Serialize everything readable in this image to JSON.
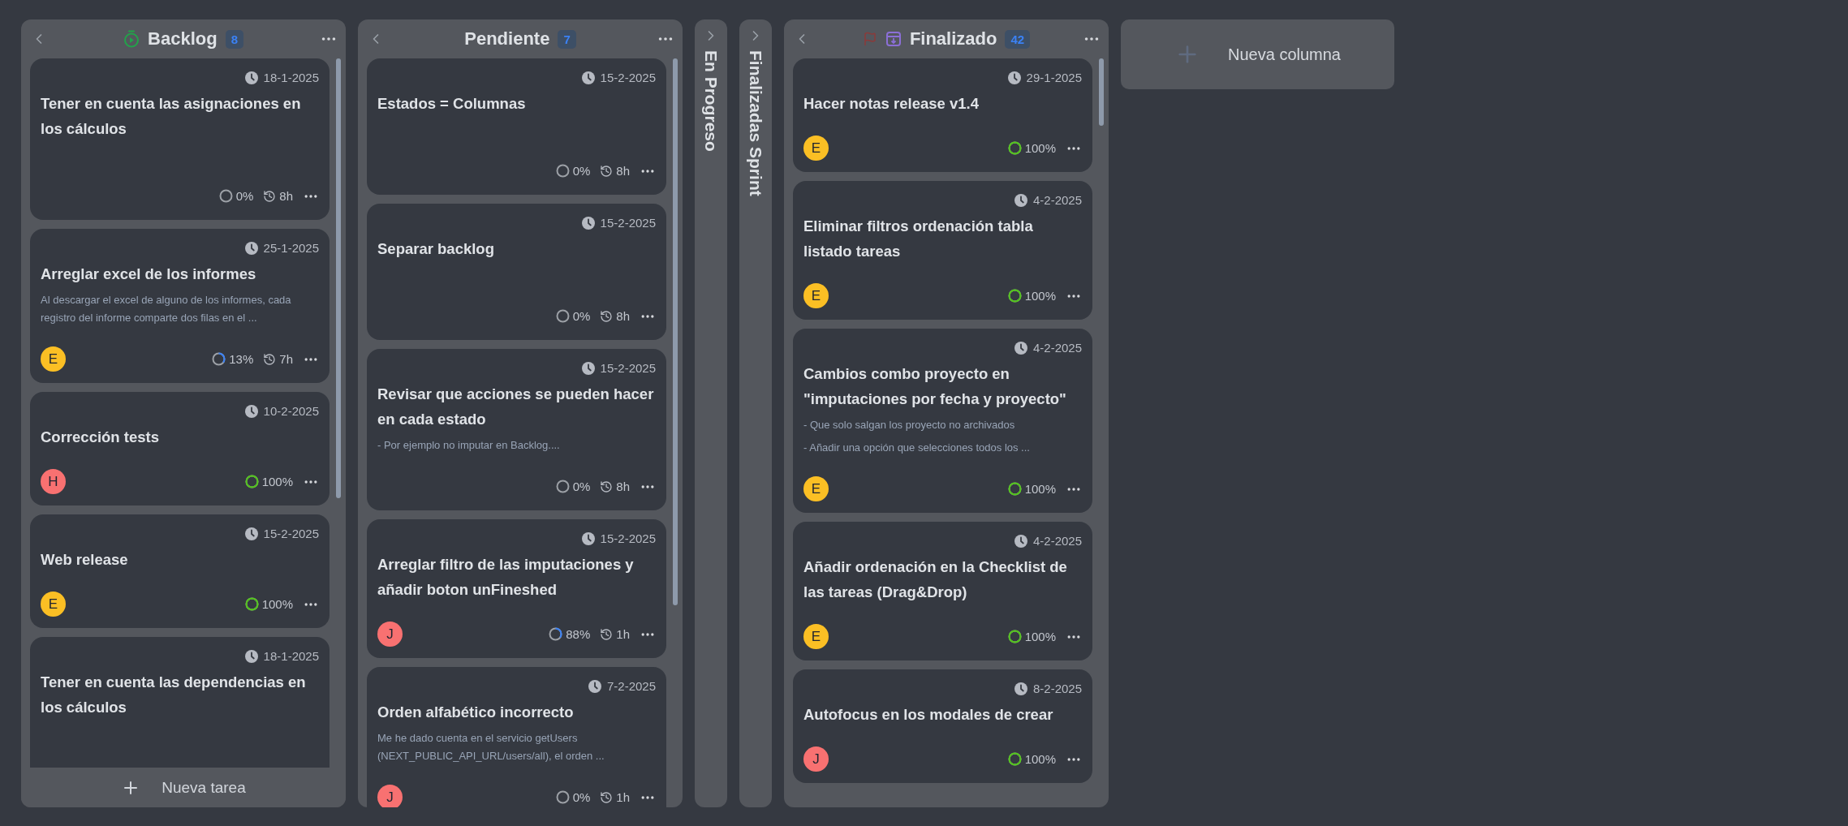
{
  "columns": [
    {
      "kind": "backlog",
      "title": "Backlog",
      "count": "8",
      "add_label": "Nueva tarea",
      "cards": [
        {
          "date": "18-1-2025",
          "title": "Tener en cuenta las asignaciones en los cálculos",
          "progress": {
            "text": "0%",
            "kind": "empty"
          },
          "hours": "8h"
        },
        {
          "date": "25-1-2025",
          "title": "Arreglar excel de los informes",
          "description": [
            "Al descargar el excel de alguno de los informes, cada registro del informe comparte dos filas en el ..."
          ],
          "assignee": {
            "initial": "E",
            "color": "#fbbf24"
          },
          "progress": {
            "text": "13%",
            "kind": "partial"
          },
          "hours": "7h"
        },
        {
          "date": "10-2-2025",
          "title": "Corrección tests",
          "assignee": {
            "initial": "H",
            "color": "#f87171"
          },
          "progress": {
            "text": "100%",
            "kind": "full"
          }
        },
        {
          "date": "15-2-2025",
          "title": "Web release",
          "assignee": {
            "initial": "E",
            "color": "#fbbf24"
          },
          "progress": {
            "text": "100%",
            "kind": "full"
          }
        },
        {
          "date": "18-1-2025",
          "title": "Tener en cuenta las dependencias en los cálculos"
        }
      ]
    },
    {
      "kind": "pending",
      "title": "Pendiente",
      "count": "7",
      "cards": [
        {
          "date": "15-2-2025",
          "title": "Estados = Columnas",
          "progress": {
            "text": "0%",
            "kind": "empty"
          },
          "hours": "8h"
        },
        {
          "date": "15-2-2025",
          "title": "Separar backlog",
          "progress": {
            "text": "0%",
            "kind": "empty"
          },
          "hours": "8h"
        },
        {
          "date": "15-2-2025",
          "title": "Revisar que acciones se pueden hacer en cada estado",
          "description": [
            "- Por ejemplo no imputar en Backlog...."
          ],
          "progress": {
            "text": "0%",
            "kind": "empty"
          },
          "hours": "8h"
        },
        {
          "date": "15-2-2025",
          "title": "Arreglar filtro de las imputaciones y añadir boton unFineshed",
          "assignee": {
            "initial": "J",
            "color": "#f87171"
          },
          "progress": {
            "text": "88%",
            "kind": "partial"
          },
          "hours": "1h"
        },
        {
          "date": "7-2-2025",
          "title": "Orden alfabético incorrecto",
          "description": [
            "Me he dado cuenta en el servicio getUsers (NEXT_PUBLIC_API_URL/users/all), el orden ..."
          ],
          "assignee": {
            "initial": "J",
            "color": "#f87171"
          },
          "progress": {
            "text": "0%",
            "kind": "empty"
          },
          "hours": "1h"
        }
      ]
    },
    {
      "kind": "collapsed",
      "title": "En Progreso"
    },
    {
      "kind": "collapsed",
      "title": "Finalizadas Sprint"
    },
    {
      "kind": "done",
      "title": "Finalizado",
      "count": "42",
      "cards": [
        {
          "date": "29-1-2025",
          "title": "Hacer notas release v1.4",
          "assignee": {
            "initial": "E",
            "color": "#fbbf24"
          },
          "progress": {
            "text": "100%",
            "kind": "full"
          }
        },
        {
          "date": "4-2-2025",
          "title": "Eliminar filtros ordenación tabla listado tareas",
          "assignee": {
            "initial": "E",
            "color": "#fbbf24"
          },
          "progress": {
            "text": "100%",
            "kind": "full"
          }
        },
        {
          "date": "4-2-2025",
          "title": "Cambios combo proyecto en \"imputaciones por fecha y proyecto\"",
          "description": [
            "- Que solo salgan los proyecto no archivados",
            "- Añadir una opción que selecciones todos los ..."
          ],
          "assignee": {
            "initial": "E",
            "color": "#fbbf24"
          },
          "progress": {
            "text": "100%",
            "kind": "full"
          }
        },
        {
          "date": "4-2-2025",
          "title": "Añadir ordenación en la Checklist de las tareas (Drag&Drop)",
          "assignee": {
            "initial": "E",
            "color": "#fbbf24"
          },
          "progress": {
            "text": "100%",
            "kind": "full"
          }
        },
        {
          "date": "8-2-2025",
          "title": "Autofocus en los modales de crear",
          "assignee": {
            "initial": "J",
            "color": "#f87171"
          },
          "progress": {
            "text": "100%",
            "kind": "full"
          }
        }
      ]
    }
  ],
  "new_column": {
    "label": "Nueva columna"
  }
}
